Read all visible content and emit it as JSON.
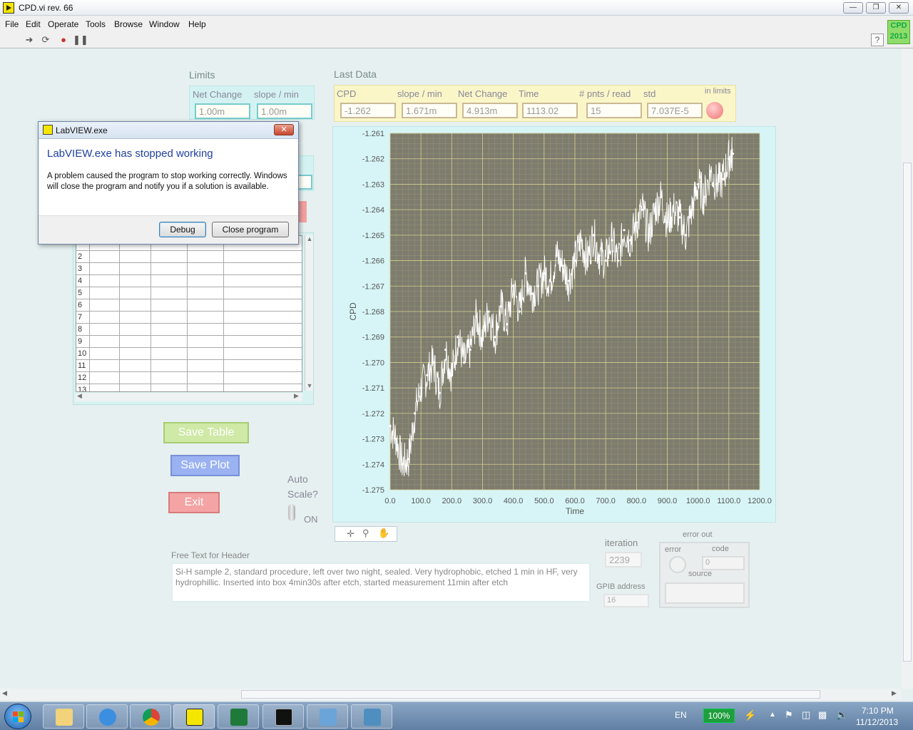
{
  "window": {
    "title": "CPD.vi rev. 66"
  },
  "menu": [
    "File",
    "Edit",
    "Operate",
    "Tools",
    "Browse",
    "Window",
    "Help"
  ],
  "badge": {
    "line1": "CPD",
    "line2": "2013"
  },
  "help": "?",
  "limits": {
    "title": "Limits",
    "net_change_label": "Net Change",
    "slope_label": "slope / min",
    "net_change_value": "1.00m",
    "slope_value": "1.00m"
  },
  "last_data": {
    "title": "Last Data",
    "labels": [
      "CPD",
      "slope / min",
      "Net Change",
      "Time",
      "# pnts / read",
      "std"
    ],
    "values": [
      "-1.262",
      "1.671m",
      "4.913m",
      "1113.02",
      "15",
      "7.037E-5"
    ],
    "in_limits_label": "in limits"
  },
  "table": {
    "row_numbers": [
      "2",
      "3",
      "4",
      "5",
      "6",
      "7",
      "8",
      "9",
      "10",
      "11",
      "12",
      "13"
    ]
  },
  "buttons": {
    "save_table": "Save Table",
    "save_plot": "Save Plot",
    "exit": "Exit"
  },
  "autoscale": {
    "label_line1": "Auto",
    "label_line2": "Scale?",
    "state": "ON"
  },
  "graph": {
    "y_label": "CPD",
    "x_label": "Time"
  },
  "chart_data": {
    "type": "scatter",
    "xlabel": "Time",
    "ylabel": "CPD",
    "xlim": [
      0,
      1200
    ],
    "ylim": [
      -1.275,
      -1.261
    ],
    "x_ticks": [
      "0.0",
      "100.0",
      "200.0",
      "300.0",
      "400.0",
      "500.0",
      "600.0",
      "700.0",
      "800.0",
      "900.0",
      "1000.0",
      "1100.0",
      "1200.0"
    ],
    "y_ticks": [
      "-1.261",
      "-1.262",
      "-1.263",
      "-1.264",
      "-1.265",
      "-1.266",
      "-1.267",
      "-1.268",
      "-1.269",
      "-1.270",
      "-1.271",
      "-1.272",
      "-1.273",
      "-1.274",
      "-1.275"
    ],
    "y_top_label": "-1.261",
    "series": [
      {
        "color": "#ffffff",
        "x": [
          0,
          20,
          40,
          60,
          80,
          100,
          120,
          140,
          160,
          180,
          200,
          220,
          240,
          260,
          280,
          300,
          320,
          340,
          360,
          380,
          400,
          420,
          440,
          460,
          480,
          500,
          520,
          540,
          560,
          580,
          600,
          620,
          640,
          660,
          680,
          700,
          720,
          740,
          760,
          780,
          800,
          820,
          840,
          860,
          880,
          900,
          920,
          940,
          960,
          980,
          1000,
          1020,
          1040,
          1060,
          1080,
          1100,
          1113
        ],
        "values": [
          -1.2725,
          -1.273,
          -1.274,
          -1.2738,
          -1.272,
          -1.271,
          -1.2705,
          -1.27,
          -1.2712,
          -1.2695,
          -1.2705,
          -1.269,
          -1.27,
          -1.2695,
          -1.2682,
          -1.269,
          -1.268,
          -1.269,
          -1.2678,
          -1.2685,
          -1.267,
          -1.268,
          -1.2665,
          -1.2673,
          -1.267,
          -1.2665,
          -1.2668,
          -1.2658,
          -1.2662,
          -1.2668,
          -1.266,
          -1.2652,
          -1.266,
          -1.265,
          -1.2658,
          -1.266,
          -1.2652,
          -1.266,
          -1.2648,
          -1.2652,
          -1.2645,
          -1.264,
          -1.265,
          -1.264,
          -1.2635,
          -1.2645,
          -1.264,
          -1.2643,
          -1.265,
          -1.264,
          -1.263,
          -1.2635,
          -1.2625,
          -1.263,
          -1.2628,
          -1.262,
          -1.2618
        ]
      }
    ]
  },
  "free_text": {
    "label": "Free Text for Header",
    "value": "Si-H sample 2, standard procedure, left over two night, sealed.  Very hydrophobic, etched 1 min in HF, very hydrophillic. Inserted into box 4min30s after etch, started measurement 11min after etch"
  },
  "iteration": {
    "label": "iteration",
    "value": "2239"
  },
  "gpib": {
    "label": "GPIB address",
    "value": "16"
  },
  "error_out": {
    "title": "error out",
    "error_label": "error",
    "code_label": "code",
    "code_value": "0",
    "source_label": "source"
  },
  "dialog": {
    "title": "LabVIEW.exe",
    "heading": "LabVIEW.exe has stopped working",
    "body": "A problem caused the program to stop working correctly. Windows will close the program and notify you if a solution is available.",
    "debug": "Debug",
    "close": "Close program",
    "close_x": "✕"
  },
  "taskbar": {
    "lang": "EN",
    "battery": "100%",
    "time": "7:10 PM",
    "date": "11/12/2013"
  }
}
